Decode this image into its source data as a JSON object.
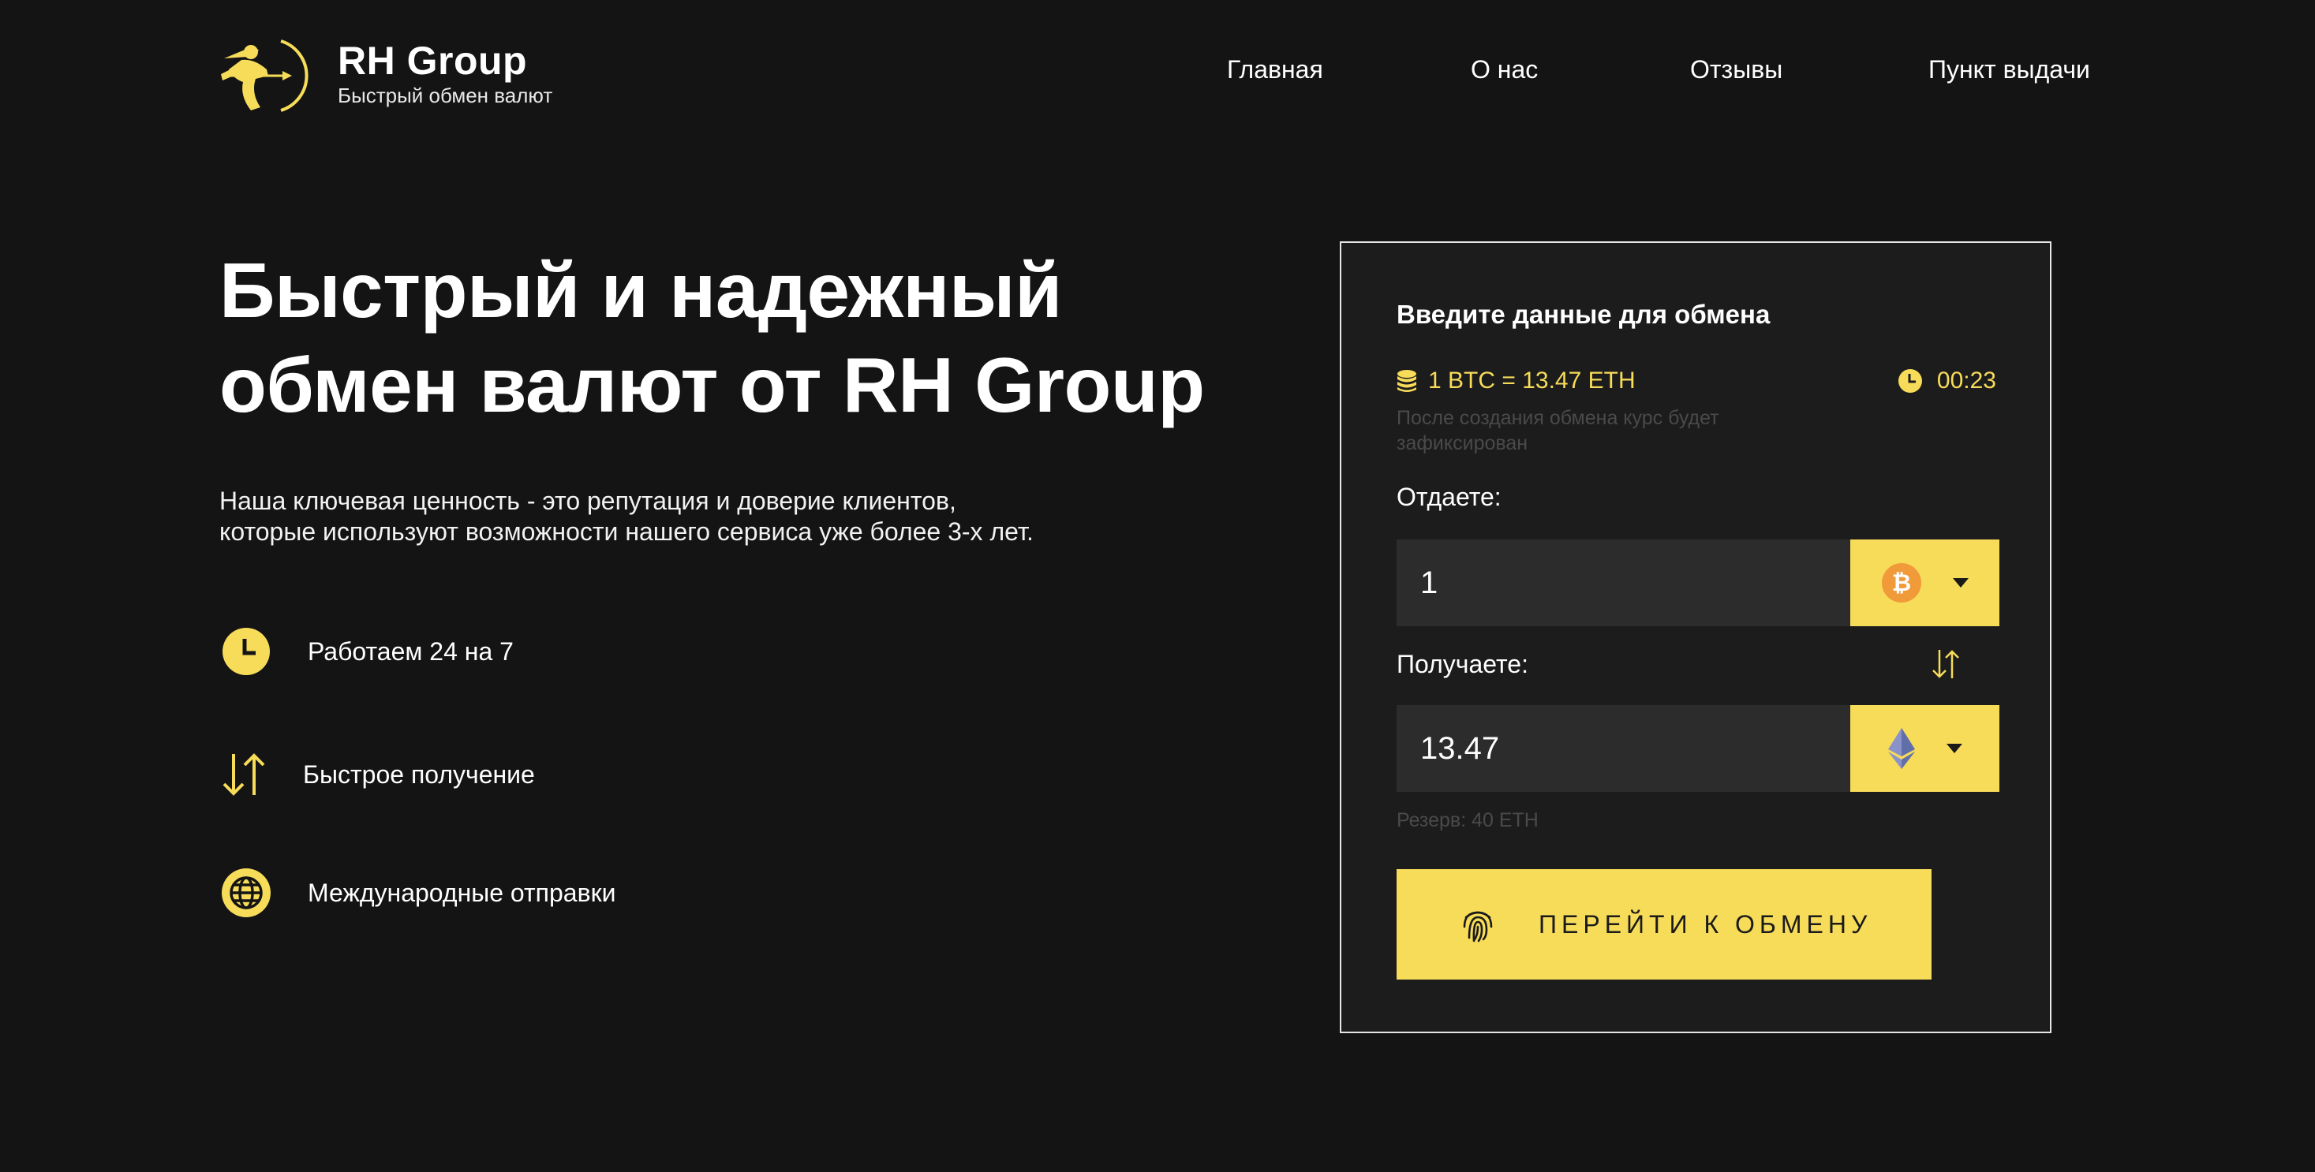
{
  "brand": {
    "name": "RH Group",
    "tagline": "Быстрый обмен валют"
  },
  "nav": {
    "items": [
      "Главная",
      "О нас",
      "Отзывы",
      "Пункт выдачи"
    ]
  },
  "hero": {
    "title_line1": "Быстрый и надежный",
    "title_line2": "обмен валют от RH Group",
    "desc_line1": "Наша ключевая ценность - это репутация и доверие клиентов,",
    "desc_line2": "которые используют возможности нашего сервиса уже более 3-х лет."
  },
  "features": [
    {
      "icon": "clock-icon",
      "label": "Работаем 24 на 7"
    },
    {
      "icon": "arrows-swap-icon",
      "label": "Быстрое получение"
    },
    {
      "icon": "globe-icon",
      "label": "Международные отправки"
    }
  ],
  "exchange": {
    "title": "Введите данные для обмена",
    "rate": "1 BTC = 13.47 ETH",
    "timer": "00:23",
    "rate_note": "После создания обмена курс будет зафиксирован",
    "give_label": "Отдаете:",
    "give_value": "1",
    "give_currency": "bitcoin-icon",
    "receive_label": "Получаете:",
    "receive_value": "13.47",
    "receive_currency": "ethereum-icon",
    "reserve": "Резерв: 40 ETH",
    "submit_label": "ПЕРЕЙТИ К ОБМЕНУ"
  },
  "colors": {
    "background": "#141414",
    "card": "#1c1c1c",
    "accent": "#f7dc59",
    "input": "#2c2c2c",
    "bitcoin": "#f09a3a"
  }
}
